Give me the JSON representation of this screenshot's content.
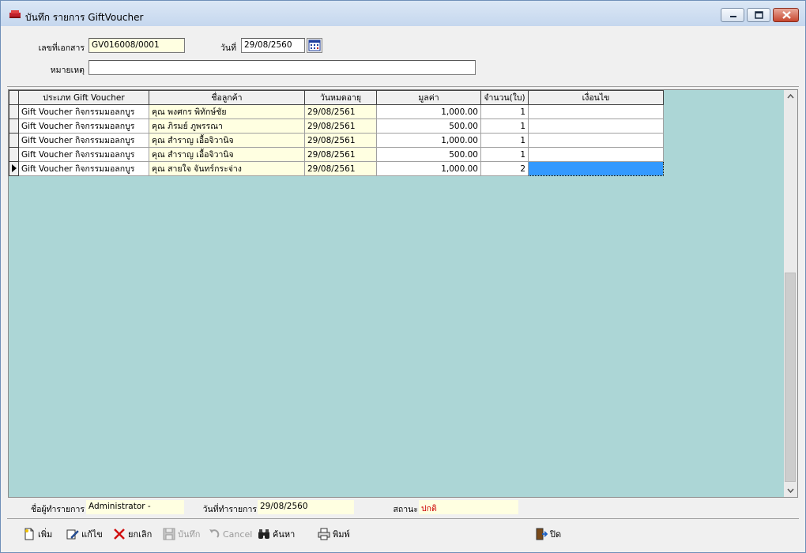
{
  "window": {
    "title": "บันทึก รายการ GiftVoucher"
  },
  "header": {
    "doc_no_label": "เลขที่เอกสาร",
    "doc_no_value": "GV016008/0001",
    "date_label": "วันที่",
    "date_value": "29/08/2560",
    "remark_label": "หมายเหตุ",
    "remark_value": ""
  },
  "grid": {
    "columns": [
      "ประเภท Gift Voucher",
      "ชื่อลูกค้า",
      "วันหมดอายุ",
      "มูลค่า",
      "จำนวน(ใบ)",
      "เงื่อนไข"
    ],
    "rows": [
      {
        "type": "Gift Voucher กิจกรรมมอลกบูร",
        "customer": "คุณ พงศกร พิทักษ์ชัย",
        "expire": "29/08/2561",
        "value": "1,000.00",
        "qty": "1",
        "condition": ""
      },
      {
        "type": "Gift Voucher กิจกรรมมอลกบูร",
        "customer": "คุณ ภิรมย์ ภูพรรณา",
        "expire": "29/08/2561",
        "value": "500.00",
        "qty": "1",
        "condition": ""
      },
      {
        "type": "Gift Voucher กิจกรรมมอลกบูร",
        "customer": "คุณ สำราญ เอื้อจิวานิจ",
        "expire": "29/08/2561",
        "value": "1,000.00",
        "qty": "1",
        "condition": ""
      },
      {
        "type": "Gift Voucher กิจกรรมมอลกบูร",
        "customer": "คุณ สำราญ เอื้อจิวานิจ",
        "expire": "29/08/2561",
        "value": "500.00",
        "qty": "1",
        "condition": ""
      },
      {
        "type": "Gift Voucher กิจกรรมมอลกบูร",
        "customer": "คุณ สายใจ จันทร์กระจ่าง",
        "expire": "29/08/2561",
        "value": "1,000.00",
        "qty": "2",
        "condition": ""
      }
    ],
    "current_row": 4
  },
  "footer": {
    "user_label": "ชื่อผู้ทำรายการ",
    "user_value": "Administrator -",
    "txn_date_label": "วันที่ทำรายการ",
    "txn_date_value": "29/08/2560",
    "status_label": "สถานะ",
    "status_value": "ปกติ",
    "status_color": "#cc0000"
  },
  "toolbar": {
    "add": "เพิ่ม",
    "edit": "แก้ไข",
    "cancel_doc": "ยกเลิก",
    "save": "บันทึก",
    "cancel": "Cancel",
    "search": "ค้นหา",
    "print": "พิมพ์",
    "close": "ปิด"
  },
  "colors": {
    "grid_bg": "#acd6d6",
    "readonly_bg": "#ffffe1",
    "selection": "#3399ff"
  },
  "icons": [
    "app-icon",
    "minimize-icon",
    "maximize-icon",
    "close-icon",
    "calendar-icon",
    "new-doc-icon",
    "edit-icon",
    "delete-x-icon",
    "save-icon",
    "undo-icon",
    "binoculars-icon",
    "printer-icon",
    "exit-door-icon"
  ]
}
